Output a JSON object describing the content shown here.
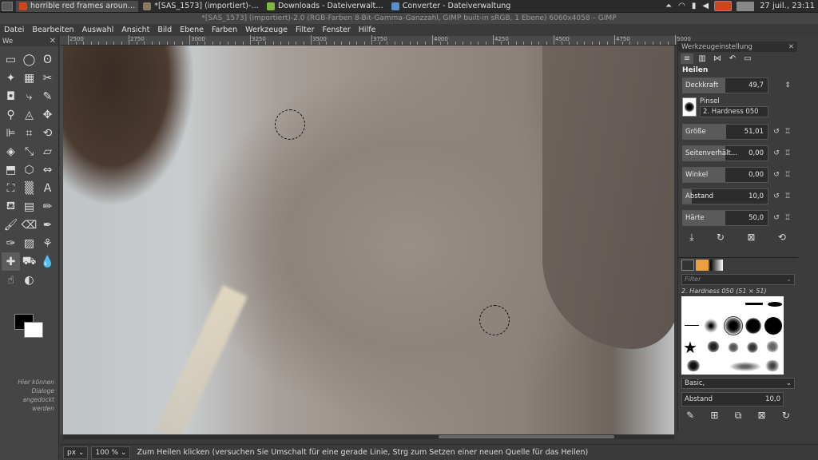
{
  "taskbar": {
    "tasks": [
      {
        "label": "horrible red frames aroun…",
        "icon": "firefox-icon",
        "color": "#d0451b"
      },
      {
        "label": "*[SAS_1573] (importiert)-…",
        "icon": "gimp-icon",
        "color": "#8a7a60"
      },
      {
        "label": "Downloads - Dateiverwalt…",
        "icon": "folder-icon",
        "color": "#7cba3f"
      },
      {
        "label": "Converter - Dateiverwaltung",
        "icon": "folder-icon",
        "color": "#5b8fc9"
      }
    ],
    "datetime": "27 juil., 23:11"
  },
  "window_title": "*[SAS_1573] (importiert)-2.0 (RGB-Farben 8-Bit-Gamma-Ganzzahl, GIMP built-in sRGB, 1 Ebene) 6060x4058 – GIMP",
  "menu": [
    "Datei",
    "Bearbeiten",
    "Auswahl",
    "Ansicht",
    "Bild",
    "Ebene",
    "Farben",
    "Werkzeuge",
    "Filter",
    "Fenster",
    "Hilfe"
  ],
  "toolbox": {
    "title": "We",
    "dock_hint": "Hier können Dialoge angedockt werden",
    "tools": [
      {
        "name": "rect-select-icon",
        "glyph": "▭"
      },
      {
        "name": "ellipse-select-icon",
        "glyph": "◯"
      },
      {
        "name": "lasso-icon",
        "glyph": "ʘ"
      },
      {
        "name": "fuzzy-select-icon",
        "glyph": "✦"
      },
      {
        "name": "color-select-icon",
        "glyph": "▦"
      },
      {
        "name": "scissors-icon",
        "glyph": "✂"
      },
      {
        "name": "foreground-select-icon",
        "glyph": "◘"
      },
      {
        "name": "paths-icon",
        "glyph": "⤷"
      },
      {
        "name": "color-picker-icon",
        "glyph": "✎"
      },
      {
        "name": "zoom-icon",
        "glyph": "⚲"
      },
      {
        "name": "measure-icon",
        "glyph": "◬"
      },
      {
        "name": "move-icon",
        "glyph": "✥"
      },
      {
        "name": "align-icon",
        "glyph": "⊫"
      },
      {
        "name": "crop-icon",
        "glyph": "⌗"
      },
      {
        "name": "unified-transform-icon",
        "glyph": "⟲"
      },
      {
        "name": "rotate-icon",
        "glyph": "◈"
      },
      {
        "name": "scale-icon",
        "glyph": "⤡"
      },
      {
        "name": "shear-icon",
        "glyph": "▱"
      },
      {
        "name": "perspective-icon",
        "glyph": "⬒"
      },
      {
        "name": "3d-transform-icon",
        "glyph": "⬡"
      },
      {
        "name": "flip-icon",
        "glyph": "⇔"
      },
      {
        "name": "cage-icon",
        "glyph": "⛶"
      },
      {
        "name": "warp-icon",
        "glyph": "▒"
      },
      {
        "name": "text-icon",
        "glyph": "A"
      },
      {
        "name": "bucket-fill-icon",
        "glyph": "⛾"
      },
      {
        "name": "gradient-icon",
        "glyph": "▤"
      },
      {
        "name": "pencil-icon",
        "glyph": "✏"
      },
      {
        "name": "paintbrush-icon",
        "glyph": "🖌"
      },
      {
        "name": "eraser-icon",
        "glyph": "⌫"
      },
      {
        "name": "airbrush-icon",
        "glyph": "✒"
      },
      {
        "name": "ink-icon",
        "glyph": "✑"
      },
      {
        "name": "mypaint-brush-icon",
        "glyph": "▨"
      },
      {
        "name": "clone-icon",
        "glyph": "⚘"
      },
      {
        "name": "heal-icon",
        "glyph": "✚",
        "selected": true
      },
      {
        "name": "perspective-clone-icon",
        "glyph": "⛟"
      },
      {
        "name": "blur-icon",
        "glyph": "💧"
      },
      {
        "name": "smudge-icon",
        "glyph": "☝"
      },
      {
        "name": "dodge-burn-icon",
        "glyph": "◐"
      }
    ]
  },
  "canvas": {
    "ruler_labels": [
      "2500",
      "2750",
      "3000",
      "3250",
      "3500",
      "3750",
      "4000",
      "4250",
      "4500",
      "4750",
      "5000"
    ],
    "image": "photo of bare back and shoulder with dark hair, heal tool cursors"
  },
  "statusbar": {
    "unit": "px",
    "zoom": "100 %",
    "message": "Zum Heilen klicken (versuchen Sie Umschalt für eine gerade Linie, Strg zum Setzen einer neuen Quelle für das Heilen)"
  },
  "tool_options": {
    "title": "Werkzeugeinstellung",
    "tool_name": "Heilen",
    "opacity": {
      "label": "Deckkraft",
      "value": "49,7",
      "fraction": 0.497
    },
    "brush_label": "Pinsel",
    "brush_name": "2. Hardness 050",
    "rows": [
      {
        "label": "Größe",
        "value": "51,01",
        "fraction": 0.51
      },
      {
        "label": "Seitenverhält...",
        "value": "0,00",
        "fraction": 0.5
      },
      {
        "label": "Winkel",
        "value": "0,00",
        "fraction": 0.5
      },
      {
        "label": "Abstand",
        "value": "10,0",
        "fraction": 0.1
      },
      {
        "label": "Härte",
        "value": "50,0",
        "fraction": 0.5
      }
    ]
  },
  "brushes": {
    "filter_placeholder": "Filter",
    "selected_name": "2. Hardness 050 (51 × 51)",
    "tag": "Basic,",
    "spacing_label": "Abstand",
    "spacing_value": "10,0"
  }
}
